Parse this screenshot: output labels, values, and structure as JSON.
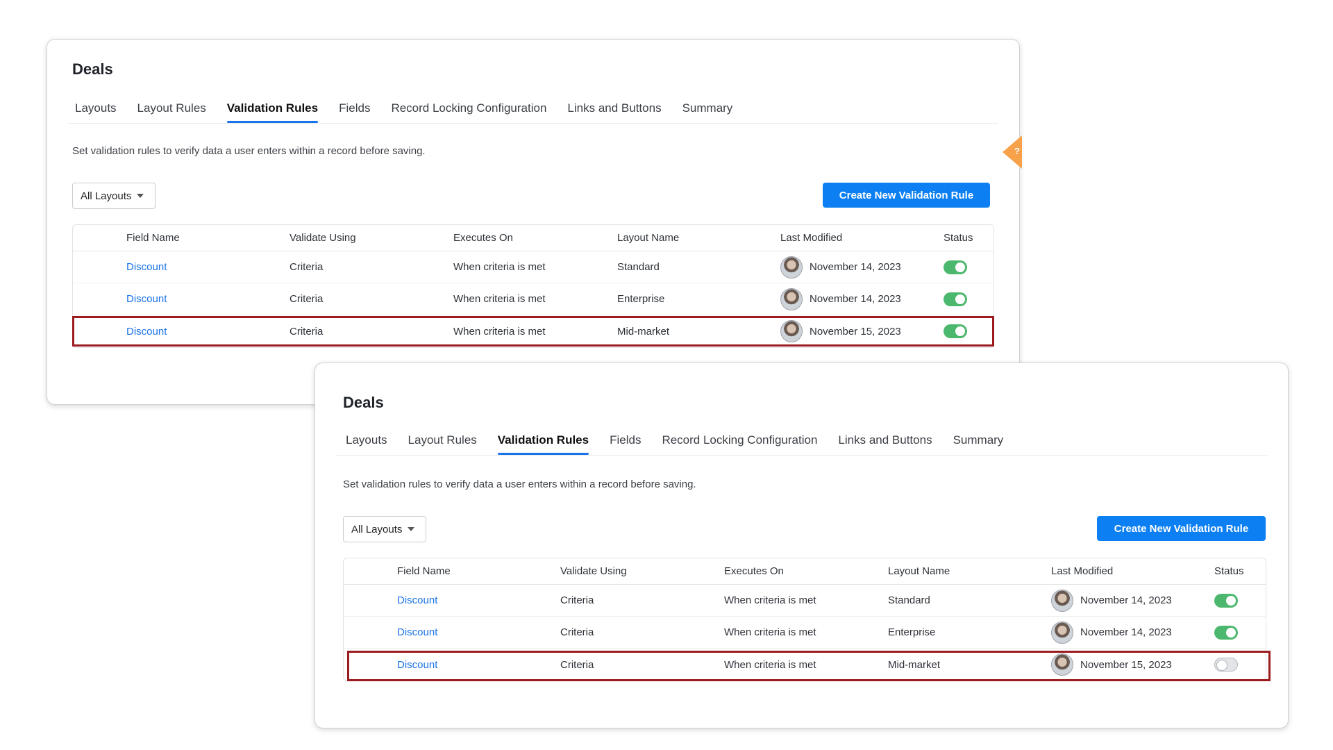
{
  "panels": [
    {
      "title": "Deals",
      "tabs": [
        "Layouts",
        "Layout Rules",
        "Validation Rules",
        "Fields",
        "Record Locking Configuration",
        "Links and Buttons",
        "Summary"
      ],
      "active_tab": "Validation Rules",
      "description": "Set validation rules to verify data a user enters within a record before saving.",
      "layout_filter": "All Layouts",
      "create_button": "Create New Validation Rule",
      "help_label": "?",
      "columns": [
        "Field Name",
        "Validate Using",
        "Executes On",
        "Layout Name",
        "Last Modified",
        "Status"
      ],
      "rows": [
        {
          "field": "Discount",
          "validate": "Criteria",
          "executes": "When criteria is met",
          "layout": "Standard",
          "modified": "November 14, 2023",
          "enabled": true
        },
        {
          "field": "Discount",
          "validate": "Criteria",
          "executes": "When criteria is met",
          "layout": "Enterprise",
          "modified": "November 14, 2023",
          "enabled": true
        },
        {
          "field": "Discount",
          "validate": "Criteria",
          "executes": "When criteria is met",
          "layout": "Mid-market",
          "modified": "November 15, 2023",
          "enabled": true
        }
      ]
    },
    {
      "title": "Deals",
      "tabs": [
        "Layouts",
        "Layout Rules",
        "Validation Rules",
        "Fields",
        "Record Locking Configuration",
        "Links and Buttons",
        "Summary"
      ],
      "active_tab": "Validation Rules",
      "description": "Set validation rules to verify data a user enters within a record before saving.",
      "layout_filter": "All Layouts",
      "create_button": "Create New Validation Rule",
      "columns": [
        "Field Name",
        "Validate Using",
        "Executes On",
        "Layout Name",
        "Last Modified",
        "Status"
      ],
      "rows": [
        {
          "field": "Discount",
          "validate": "Criteria",
          "executes": "When criteria is met",
          "layout": "Standard",
          "modified": "November 14, 2023",
          "enabled": true
        },
        {
          "field": "Discount",
          "validate": "Criteria",
          "executes": "When criteria is met",
          "layout": "Enterprise",
          "modified": "November 14, 2023",
          "enabled": true
        },
        {
          "field": "Discount",
          "validate": "Criteria",
          "executes": "When criteria is met",
          "layout": "Mid-market",
          "modified": "November 15, 2023",
          "enabled": false
        }
      ]
    }
  ],
  "colors": {
    "accent": "#1a73e8",
    "button": "#0c7ff2",
    "toggle_on": "#4cb86e",
    "highlight": "#9b1b1f",
    "help_tab": "#f7a24b"
  }
}
